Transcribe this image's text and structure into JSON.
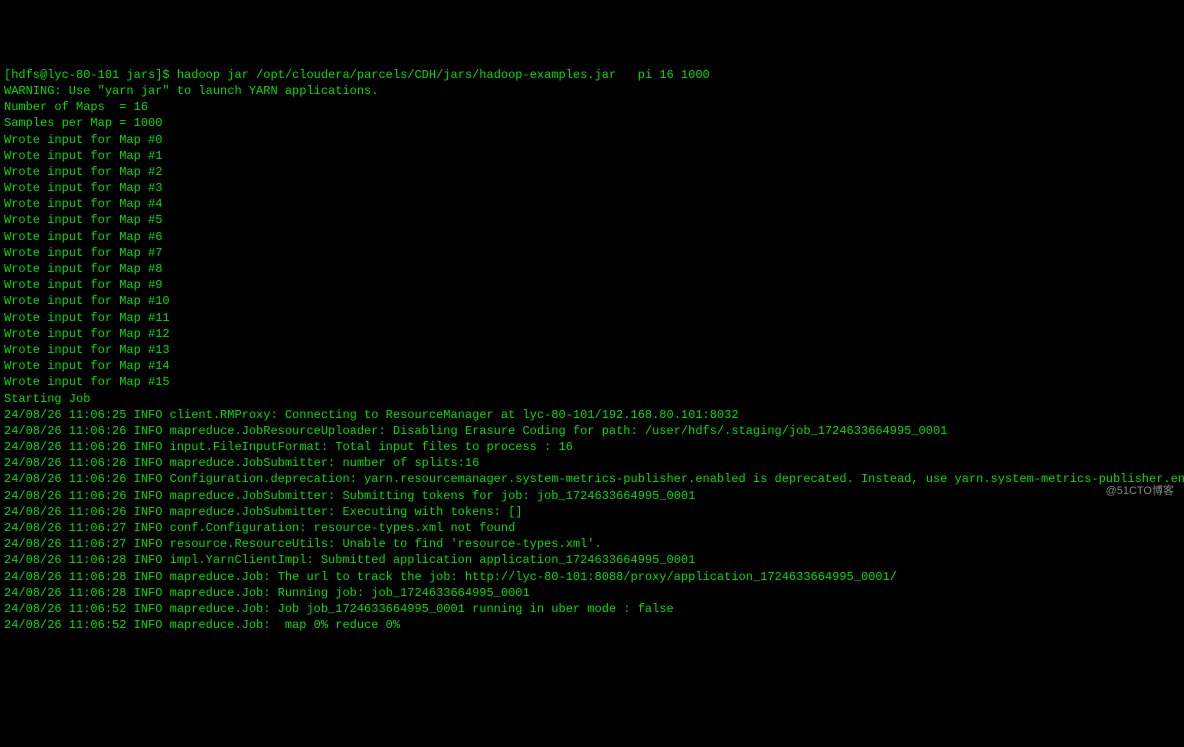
{
  "prompt": {
    "user_host": "[hdfs@lyc-80-101 jars]$",
    "command": " hadoop jar /opt/cloudera/parcels/CDH/jars/hadoop-examples.jar   pi 16 1000"
  },
  "lines": [
    "WARNING: Use \"yarn jar\" to launch YARN applications.",
    "Number of Maps  = 16",
    "Samples per Map = 1000",
    "Wrote input for Map #0",
    "Wrote input for Map #1",
    "Wrote input for Map #2",
    "Wrote input for Map #3",
    "Wrote input for Map #4",
    "Wrote input for Map #5",
    "Wrote input for Map #6",
    "Wrote input for Map #7",
    "Wrote input for Map #8",
    "Wrote input for Map #9",
    "Wrote input for Map #10",
    "Wrote input for Map #11",
    "Wrote input for Map #12",
    "Wrote input for Map #13",
    "Wrote input for Map #14",
    "Wrote input for Map #15",
    "Starting Job",
    "24/08/26 11:06:25 INFO client.RMProxy: Connecting to ResourceManager at lyc-80-101/192.168.80.101:8032",
    "24/08/26 11:06:26 INFO mapreduce.JobResourceUploader: Disabling Erasure Coding for path: /user/hdfs/.staging/job_1724633664995_0001",
    "24/08/26 11:06:26 INFO input.FileInputFormat: Total input files to process : 16",
    "24/08/26 11:06:26 INFO mapreduce.JobSubmitter: number of splits:16",
    "24/08/26 11:06:26 INFO Configuration.deprecation: yarn.resourcemanager.system-metrics-publisher.enabled is deprecated. Instead, use yarn.system-metrics-publisher.enabled",
    "24/08/26 11:06:26 INFO mapreduce.JobSubmitter: Submitting tokens for job: job_1724633664995_0001",
    "24/08/26 11:06:26 INFO mapreduce.JobSubmitter: Executing with tokens: []",
    "24/08/26 11:06:27 INFO conf.Configuration: resource-types.xml not found",
    "24/08/26 11:06:27 INFO resource.ResourceUtils: Unable to find 'resource-types.xml'.",
    "24/08/26 11:06:28 INFO impl.YarnClientImpl: Submitted application application_1724633664995_0001",
    "24/08/26 11:06:28 INFO mapreduce.Job: The url to track the job: http://lyc-80-101:8088/proxy/application_1724633664995_0001/",
    "24/08/26 11:06:28 INFO mapreduce.Job: Running job: job_1724633664995_0001",
    "24/08/26 11:06:52 INFO mapreduce.Job: Job job_1724633664995_0001 running in uber mode : false",
    "24/08/26 11:06:52 INFO mapreduce.Job:  map 0% reduce 0%"
  ],
  "watermark": "@51CTO博客"
}
